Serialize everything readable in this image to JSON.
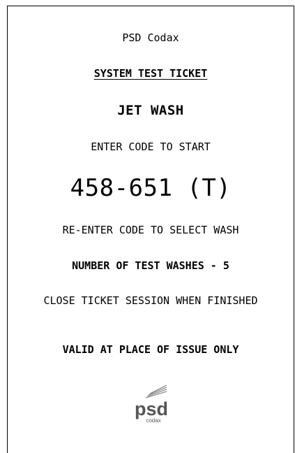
{
  "ticket": {
    "brand": "PSD Codax",
    "heading": "SYSTEM TEST TICKET",
    "product": "JET WASH",
    "instruction_start": "ENTER CODE TO START",
    "code": "458-651 (T)",
    "instruction_select": "RE-ENTER CODE TO SELECT WASH",
    "test_washes": "NUMBER OF TEST WASHES - 5",
    "instruction_close": "CLOSE TICKET SESSION WHEN FINISHED",
    "validity": "VALID AT PLACE OF ISSUE ONLY"
  },
  "logo": {
    "icon": "psd-codax-logo",
    "wordmark": "psd",
    "subtext": "codax"
  }
}
